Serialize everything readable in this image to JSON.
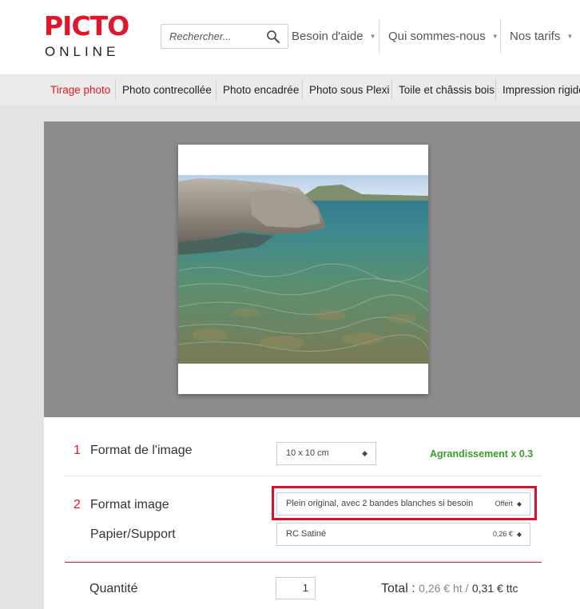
{
  "header": {
    "logo_top": "PICTO",
    "logo_bottom": "ONLINE",
    "search_placeholder": "Rechercher...",
    "nav": [
      {
        "label": "Besoin d'aide"
      },
      {
        "label": "Qui sommes-nous"
      },
      {
        "label": "Nos tarifs"
      }
    ]
  },
  "categories": [
    {
      "label": "Tirage photo",
      "active": true
    },
    {
      "label": "Photo contrecollée"
    },
    {
      "label": "Photo encadrée"
    },
    {
      "label": "Photo sous Plexi"
    },
    {
      "label": "Toile et châssis bois"
    },
    {
      "label": "Impression rigide"
    }
  ],
  "config": {
    "step1": {
      "number": "1",
      "label": "Format de l'image",
      "value": "10 x 10 cm",
      "note": "Agrandissement x 0.3"
    },
    "step2": {
      "number": "2",
      "label": "Format image",
      "value": "Plein original, avec 2 bandes blanches si besoin",
      "price": "Offert"
    },
    "paper": {
      "label": "Papier/Support",
      "value": "RC Satiné",
      "price": "0,26 €"
    },
    "quantity": {
      "label": "Quantité",
      "value": "1"
    },
    "total": {
      "label": "Total :",
      "ht": "0,26 € ht /",
      "ttc": "0,31 € ttc"
    }
  },
  "colors": {
    "brand": "#e0162b",
    "accent_green": "#3b9d2a",
    "highlight": "#d8102d"
  }
}
